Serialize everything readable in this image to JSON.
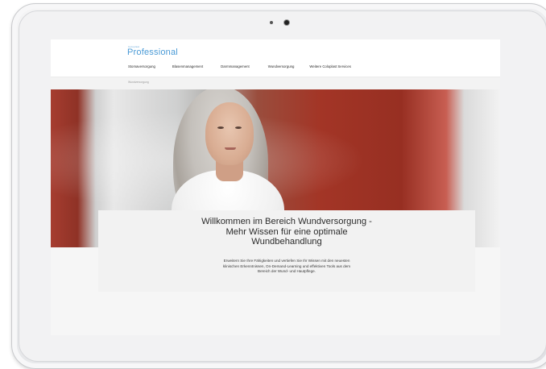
{
  "header": {
    "logo_small": "Coloplast",
    "logo": "Professional",
    "nav": [
      "Stomaversorgung",
      "Blasenmanagement",
      "Darmmanagement",
      "Wundversorgung",
      "Weitere Coloplast Services"
    ]
  },
  "breadcrumb": "Wundversorgung",
  "hero": {
    "title_lines": [
      "Willkommen im Bereich Wundversorgung -",
      "Mehr Wissen für eine optimale",
      "Wundbehandlung"
    ],
    "body_lines": [
      "Erweitern Sie Ihre Fähigkeiten und vertiefen Sie Ihr Wissen mit den neuesten",
      "klinischen Erkenntnissen, On-Demand-Learning und effektiven Tools aus dem",
      "Bereich der Wund- und Hautpflege."
    ]
  },
  "colors": {
    "logo_blue": "#4a9ad6",
    "hero_red": "#a33526",
    "card_bg": "#f2f2f2"
  }
}
